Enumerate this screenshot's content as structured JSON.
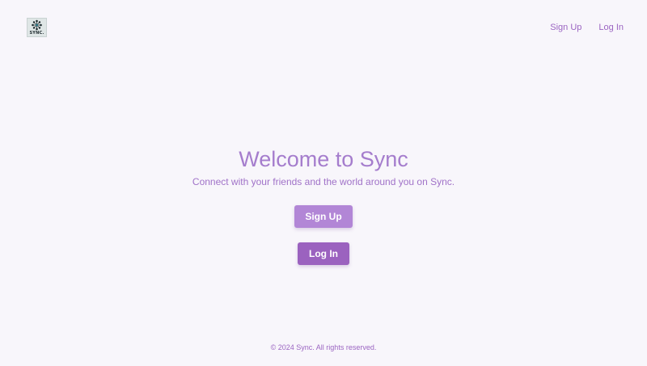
{
  "brand": {
    "logo_text": "SYNC.",
    "colors": {
      "primary": "#9b62bf",
      "light": "#b286d6",
      "title": "#a57dcd",
      "background": "#f8f6fb"
    }
  },
  "nav": {
    "signup_label": "Sign Up",
    "login_label": "Log In"
  },
  "hero": {
    "title": "Welcome to Sync",
    "subtitle": "Connect with your friends and the world around you on Sync."
  },
  "actions": {
    "signup_label": "Sign Up",
    "login_label": "Log In"
  },
  "footer": {
    "text": "© 2024 Sync. All rights reserved."
  }
}
